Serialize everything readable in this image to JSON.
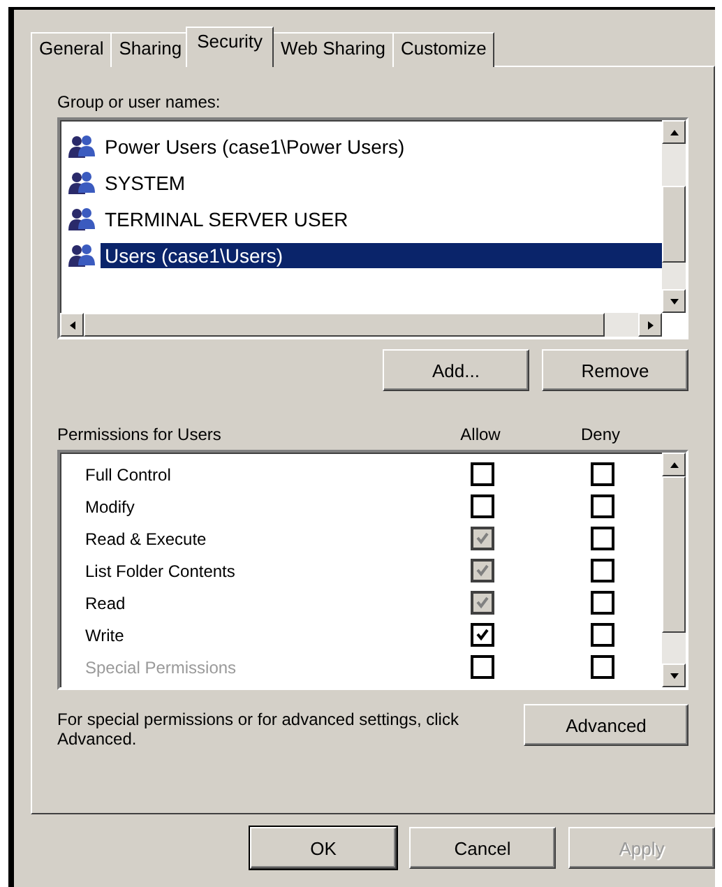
{
  "tabs": [
    {
      "label": "General",
      "selected": false
    },
    {
      "label": "Sharing",
      "selected": false
    },
    {
      "label": "Security",
      "selected": true
    },
    {
      "label": "Web Sharing",
      "selected": false
    },
    {
      "label": "Customize",
      "selected": false
    }
  ],
  "users": {
    "label": "Group or user names:",
    "items": [
      {
        "name": "Power Users (case1\\Power Users)",
        "selected": false
      },
      {
        "name": "SYSTEM",
        "selected": false
      },
      {
        "name": "TERMINAL SERVER USER",
        "selected": false
      },
      {
        "name": "Users (case1\\Users)",
        "selected": true
      }
    ],
    "buttons": [
      {
        "label": "Add...",
        "disabled": false
      },
      {
        "label": "Remove",
        "disabled": false
      }
    ]
  },
  "permissions": {
    "label": "Permissions for Users",
    "columns": [
      "Allow",
      "Deny"
    ],
    "rows": [
      {
        "name": "Full Control",
        "allow": {
          "checked": false,
          "disabled": false
        },
        "deny": {
          "checked": false,
          "disabled": false
        }
      },
      {
        "name": "Modify",
        "allow": {
          "checked": false,
          "disabled": false
        },
        "deny": {
          "checked": false,
          "disabled": false
        }
      },
      {
        "name": "Read & Execute",
        "allow": {
          "checked": true,
          "disabled": true
        },
        "deny": {
          "checked": false,
          "disabled": false
        }
      },
      {
        "name": "List Folder Contents",
        "allow": {
          "checked": true,
          "disabled": true
        },
        "deny": {
          "checked": false,
          "disabled": false
        }
      },
      {
        "name": "Read",
        "allow": {
          "checked": true,
          "disabled": true
        },
        "deny": {
          "checked": false,
          "disabled": false
        }
      },
      {
        "name": "Write",
        "allow": {
          "checked": true,
          "disabled": false
        },
        "deny": {
          "checked": false,
          "disabled": false
        }
      },
      {
        "name": "Special Permissions",
        "allow": {
          "checked": false,
          "disabled": false
        },
        "deny": {
          "checked": false,
          "disabled": false
        }
      }
    ]
  },
  "advanced": {
    "text": "For special permissions or for advanced settings, click Advanced.",
    "button": {
      "label": "Advanced",
      "disabled": false
    }
  },
  "dialog_buttons": [
    {
      "label": "OK",
      "disabled": false,
      "default": true
    },
    {
      "label": "Cancel",
      "disabled": false,
      "default": false
    },
    {
      "label": "Apply",
      "disabled": true,
      "default": false
    }
  ]
}
